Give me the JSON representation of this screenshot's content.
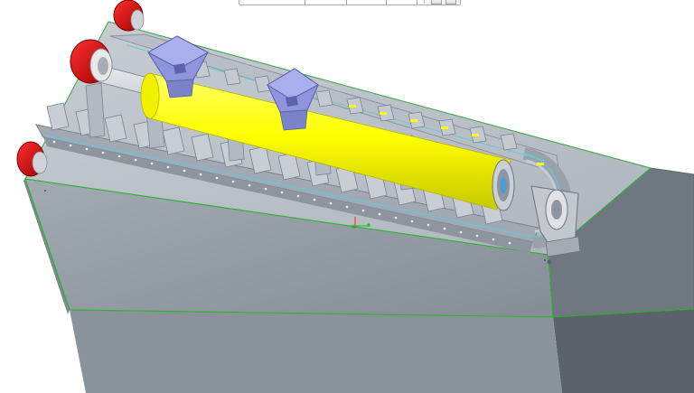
{
  "viewport": {
    "background": "#ffffff",
    "view_mode": "shaded-3d",
    "model": {
      "parts": [
        {
          "name": "base-block",
          "color": "#8f98a3"
        },
        {
          "name": "conveyor-trough",
          "color": "#b4bbc3"
        },
        {
          "name": "roller-tube",
          "color": "#ffff00"
        },
        {
          "name": "feed-hopper",
          "color": "#8e95dc"
        },
        {
          "name": "drive-wheel",
          "color": "#d40000"
        },
        {
          "name": "end-bracket",
          "color": "#c3c8ce"
        },
        {
          "name": "chain-track",
          "color": "#a9b0b8"
        }
      ],
      "edge_highlight_color": "#22bb22",
      "datum_color": "#ff2222"
    }
  },
  "toolbar": {
    "icons": [
      "dropdown-icon",
      "view-button-icon",
      "view-button-icon"
    ]
  }
}
